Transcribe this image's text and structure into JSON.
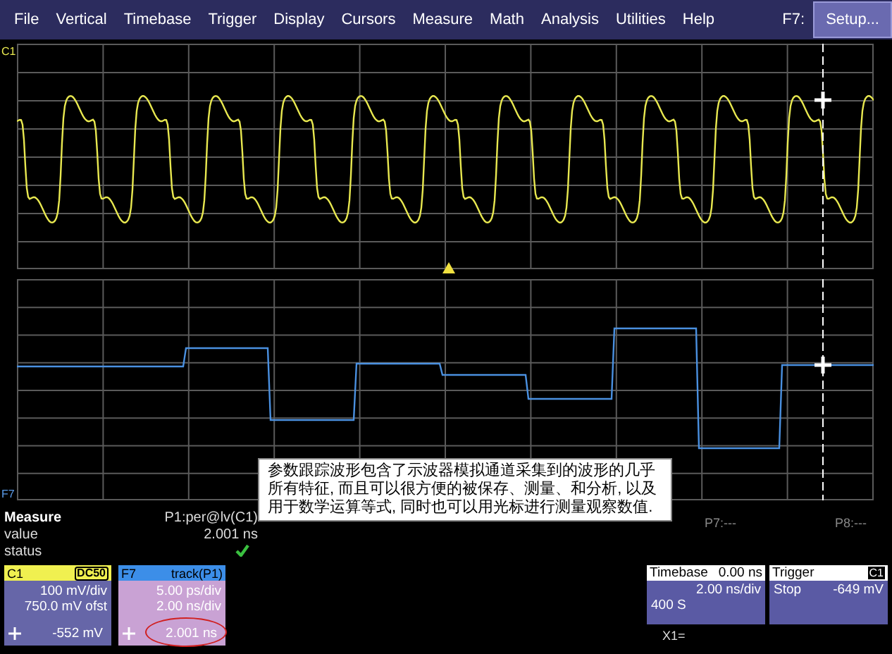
{
  "menu": [
    {
      "label": "File"
    },
    {
      "label": "Vertical"
    },
    {
      "label": "Timebase"
    },
    {
      "label": "Trigger"
    },
    {
      "label": "Display"
    },
    {
      "label": "Cursors"
    },
    {
      "label": "Measure"
    },
    {
      "label": "Math"
    },
    {
      "label": "Analysis"
    },
    {
      "label": "Utilities"
    },
    {
      "label": "Help"
    }
  ],
  "setup": {
    "key": "F7:",
    "button": "Setup..."
  },
  "top_grid": {
    "channel_label": "C1"
  },
  "bottom_grid": {
    "channel_label": "F7",
    "parameter_labels": [
      "P7:---",
      "P8:---"
    ]
  },
  "note": "参数跟踪波形包含了示波器模拟通道采集到的波形的几乎所有特征, 而且可以很方便的被保存、测量、和分析, 以及用于数学运算等式, 同时也可以用光标进行测量观察数值.",
  "measure": {
    "title": "Measure",
    "parameter": "P1:per@lv(C1)",
    "value_label": "value",
    "value": "2.001 ns",
    "status_label": "status",
    "status_ok": true
  },
  "channels": [
    {
      "name": "C1",
      "tag": "DC50",
      "lines": [
        "100 mV/div",
        "750.0 mV ofst"
      ],
      "reading": "-552 mV",
      "color": "#f0f050",
      "circled": false
    },
    {
      "name": "F7",
      "tag": "track(P1)",
      "lines": [
        "5.00 ps/div",
        "2.00 ns/div"
      ],
      "reading": "2.001 ns",
      "color": "#3c8ee8",
      "circled": true
    }
  ],
  "timebase": {
    "title": "Timebase",
    "delay": "0.00 ns",
    "scale": "2.00 ns/div",
    "samples": "400 S"
  },
  "trigger": {
    "title": "Trigger",
    "tag": "C1",
    "mode": "Stop",
    "threshold": "-649 mV"
  },
  "cursor_readout": "X1="
}
